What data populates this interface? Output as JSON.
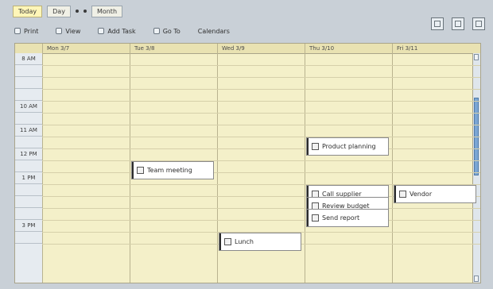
{
  "toolbar_top": {
    "tab_selected": "Today",
    "tab_2": "Day",
    "tab_3": "Month"
  },
  "toolbar_main": {
    "buttons": [
      "Print",
      "View",
      "Add Task",
      "Go To",
      "Calendars"
    ]
  },
  "calendar": {
    "columns": [
      "Mon 3/7",
      "Tue 3/8",
      "Wed 3/9",
      "Thu 3/10",
      "Fri 3/11"
    ],
    "times": [
      "8 AM",
      "",
      "",
      "",
      "10 AM",
      "",
      "11 AM",
      "",
      "12 PM",
      "",
      "1 PM",
      "",
      "",
      "",
      "3 PM",
      ""
    ],
    "events": [
      {
        "day": 1,
        "start": 9,
        "label": "Team meeting"
      },
      {
        "day": 3,
        "start": 7,
        "label": "Product planning"
      },
      {
        "day": 3,
        "start": 11,
        "label": "Call supplier"
      },
      {
        "day": 3,
        "start": 12,
        "label": "Review budget"
      },
      {
        "day": 3,
        "start": 13,
        "label": "Send report"
      },
      {
        "day": 4,
        "start": 11,
        "label": "Vendor"
      },
      {
        "day": 2,
        "start": 15,
        "label": "Lunch"
      }
    ]
  }
}
